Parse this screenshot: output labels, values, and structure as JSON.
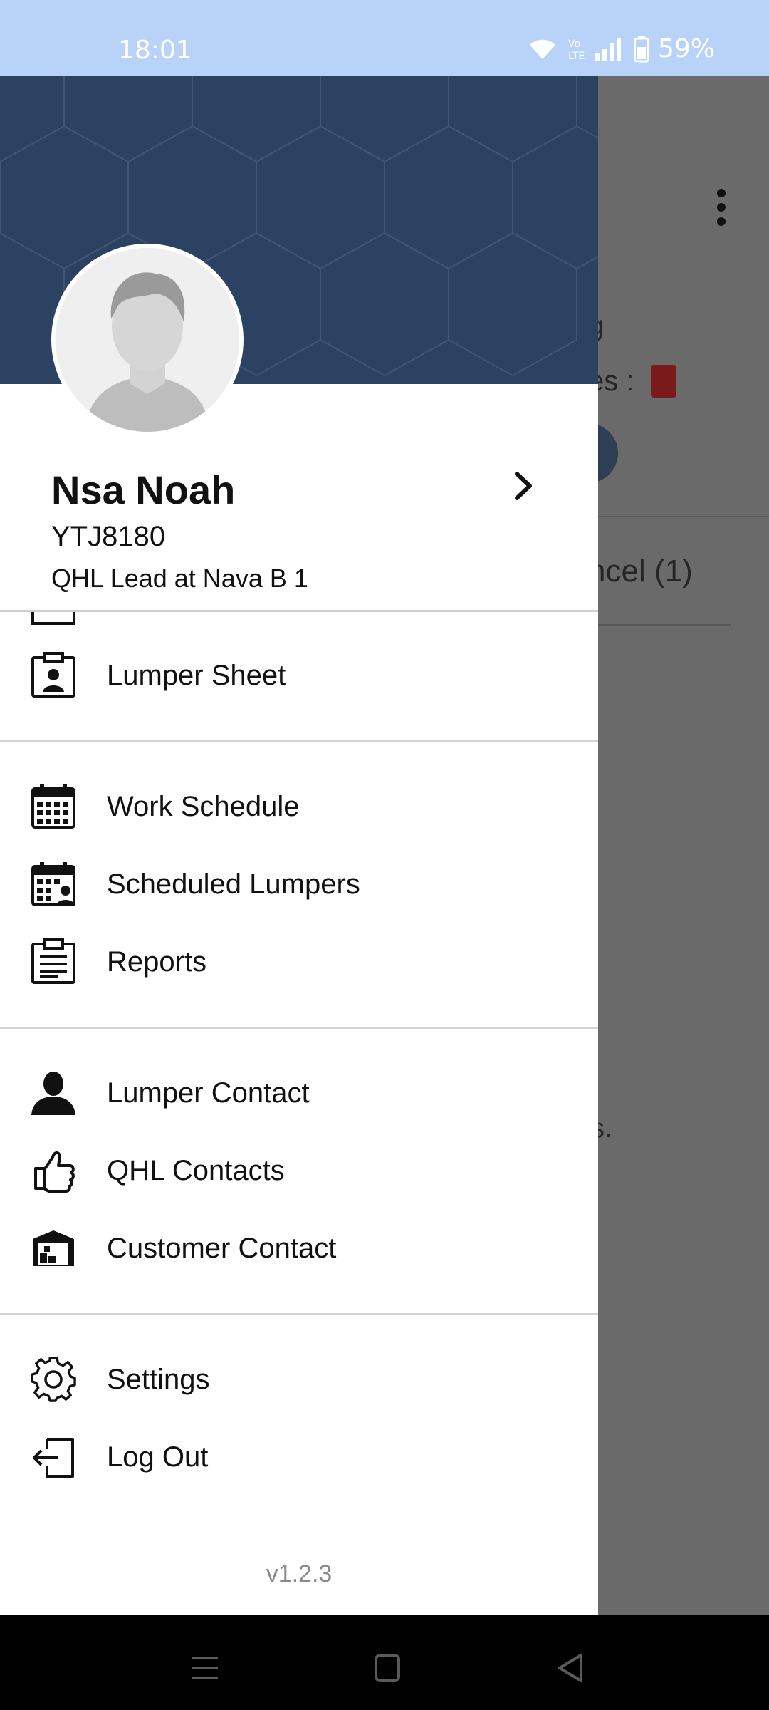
{
  "status_bar": {
    "time": "18:01",
    "battery_percent": "59%",
    "icons": [
      "wifi-icon",
      "volte-icon",
      "signal-icon",
      "battery-icon"
    ]
  },
  "background_screen": {
    "partial_text_1": "g",
    "partial_text_2": "es :",
    "partial_tab": "ncel (1)",
    "partial_text_3": "s."
  },
  "drawer": {
    "profile": {
      "name": "Nsa Noah",
      "id": "YTJ8180",
      "role": "QHL Lead at Nava B 1"
    },
    "menu": [
      {
        "label": "Lumper Sheet",
        "icon": "clipboard-person-icon"
      },
      {
        "label": "Work Schedule",
        "icon": "calendar-icon"
      },
      {
        "label": "Scheduled Lumpers",
        "icon": "calendar-person-icon"
      },
      {
        "label": "Reports",
        "icon": "clipboard-list-icon"
      },
      {
        "label": "Lumper Contact",
        "icon": "person-icon"
      },
      {
        "label": "QHL Contacts",
        "icon": "thumbs-up-icon"
      },
      {
        "label": "Customer Contact",
        "icon": "warehouse-icon"
      },
      {
        "label": "Settings",
        "icon": "gear-icon"
      },
      {
        "label": "Log Out",
        "icon": "logout-icon"
      }
    ],
    "version": "v1.2.3"
  },
  "colors": {
    "status_bar": "#b9d3f8",
    "drawer_header": "#2c4263",
    "scrim": "#6b6b6b",
    "text": "#111111"
  }
}
